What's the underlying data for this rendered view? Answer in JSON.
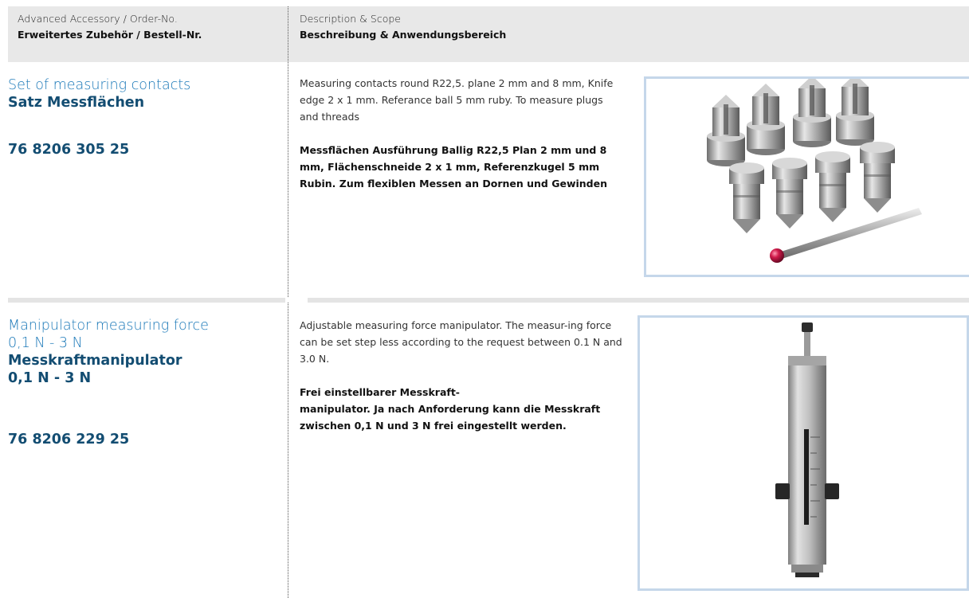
{
  "header": {
    "col1_en": "Advanced Accessory / Order-No.",
    "col1_de": "Erweitertes Zubehör / Bestell-Nr.",
    "col2_en": "Description & Scope",
    "col2_de": "Beschreibung & Anwendungsbereich"
  },
  "items": [
    {
      "title_en": "Set of measuring contacts",
      "title_de": "Satz Messflächen",
      "order_no": "76 8206 305 25",
      "desc_en": "Measuring contacts round R22,5. plane 2 mm and 8 mm, Knife edge 2 x 1 mm. Referance ball 5 mm ruby. To measure plugs and threads",
      "desc_de": "Messflächen Ausführung Ballig R22,5 Plan 2 mm und 8 mm, Flächenschneide 2 x 1 mm, Referenzkugel 5 mm Rubin. Zum flexiblen Messen an Dornen und Gewinden"
    },
    {
      "title_en_line1": "Manipulator measuring force",
      "title_en_line2": "0,1 N - 3 N",
      "title_de_line1": "Messkraftmanipulator",
      "title_de_line2": "0,1 N - 3 N",
      "order_no": "76 8206 229 25",
      "desc_en": "Adjustable measuring force manipulator. The measur-ing force can be set step less according to the request between 0.1 N and 3.0 N.",
      "desc_de_line1": "Frei einstellbarer Messkraft-",
      "desc_de_line2": "manipulator. Ja nach Anforderung kann die Messkraft zwischen 0,1 N und 3 N frei eingestellt werden."
    }
  ]
}
